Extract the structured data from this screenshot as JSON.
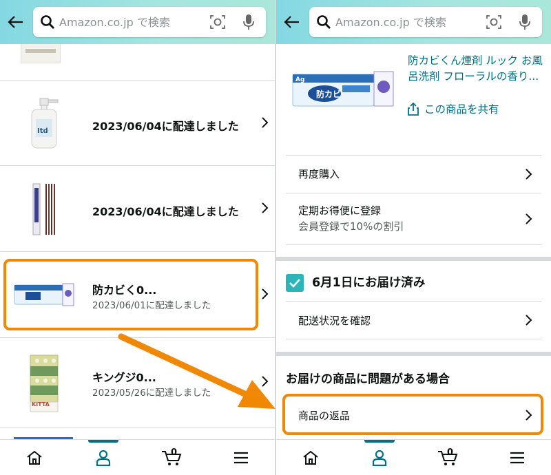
{
  "search": {
    "placeholder": "Amazon.co.jp で検索"
  },
  "left": {
    "orders": [
      {
        "title": "2023/06/04に配達しました",
        "subtitle": ""
      },
      {
        "title": "2023/06/04に配達しました",
        "subtitle": ""
      },
      {
        "title": "防カビく0...",
        "subtitle": "2023/06/01に配達しました"
      },
      {
        "title": "キングジ0...",
        "subtitle": "2023/05/26に配達しました"
      }
    ],
    "thumb_brand": "KITTA",
    "thumb_pump_label": "Itd"
  },
  "right": {
    "product": {
      "title": "防カビくん煙剤 ルック お風呂洗剤 フローラルの香り...",
      "share_label": "この商品を共有",
      "package_text": "防カビ",
      "package_badge": "Ag"
    },
    "actions": {
      "rebuy": "再度購入",
      "subscribe": "定期お得便に登録",
      "subscribe_sub": "会員登録で10%の割引",
      "track": "配送状況を確認",
      "return": "商品の返品"
    },
    "delivery_status": "6月1日にお届け済み",
    "problem_heading": "お届けの商品に問題がある場合"
  },
  "nav": {
    "cart_count": "0"
  },
  "colors": {
    "accent": "#f08804",
    "link": "#007185",
    "check": "#2bb5b8",
    "header": "#a6e6e0"
  }
}
